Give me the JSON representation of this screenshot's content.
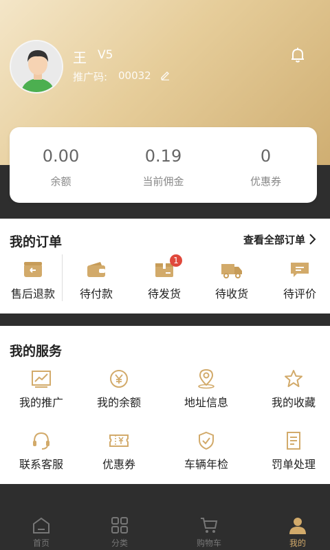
{
  "profile": {
    "name": "王",
    "level": "V5",
    "promo_label": "推广码:",
    "promo_code": "00032"
  },
  "stats": [
    {
      "value": "0.00",
      "label": "余额"
    },
    {
      "value": "0.19",
      "label": "当前佣金"
    },
    {
      "value": "0",
      "label": "优惠券"
    }
  ],
  "orders": {
    "title": "我的订单",
    "view_all": "查看全部订单",
    "items": [
      {
        "label": "售后退款",
        "icon": "refund-icon"
      },
      {
        "label": "待付款",
        "icon": "wallet-icon"
      },
      {
        "label": "待发货",
        "icon": "package-icon",
        "badge": "1"
      },
      {
        "label": "待收货",
        "icon": "truck-icon"
      },
      {
        "label": "待评价",
        "icon": "comment-icon"
      }
    ]
  },
  "services": {
    "title": "我的服务",
    "items": [
      {
        "label": "我的推广",
        "icon": "chart-icon"
      },
      {
        "label": "我的余额",
        "icon": "yen-coin-icon"
      },
      {
        "label": "地址信息",
        "icon": "location-pin-icon"
      },
      {
        "label": "我的收藏",
        "icon": "star-icon"
      },
      {
        "label": "联系客服",
        "icon": "headset-icon"
      },
      {
        "label": "优惠券",
        "icon": "coupon-icon"
      },
      {
        "label": "车辆年检",
        "icon": "shield-check-icon"
      },
      {
        "label": "罚单处理",
        "icon": "ticket-document-icon"
      }
    ]
  },
  "tabs": [
    {
      "label": "首页",
      "icon": "home-icon"
    },
    {
      "label": "分类",
      "icon": "grid-icon"
    },
    {
      "label": "购物车",
      "icon": "cart-icon"
    },
    {
      "label": "我的",
      "icon": "user-icon",
      "active": true
    }
  ],
  "colors": {
    "accent_gold": "#d2aa6a",
    "badge_red": "#e0483b",
    "dark_bg": "#2e2e2e"
  }
}
